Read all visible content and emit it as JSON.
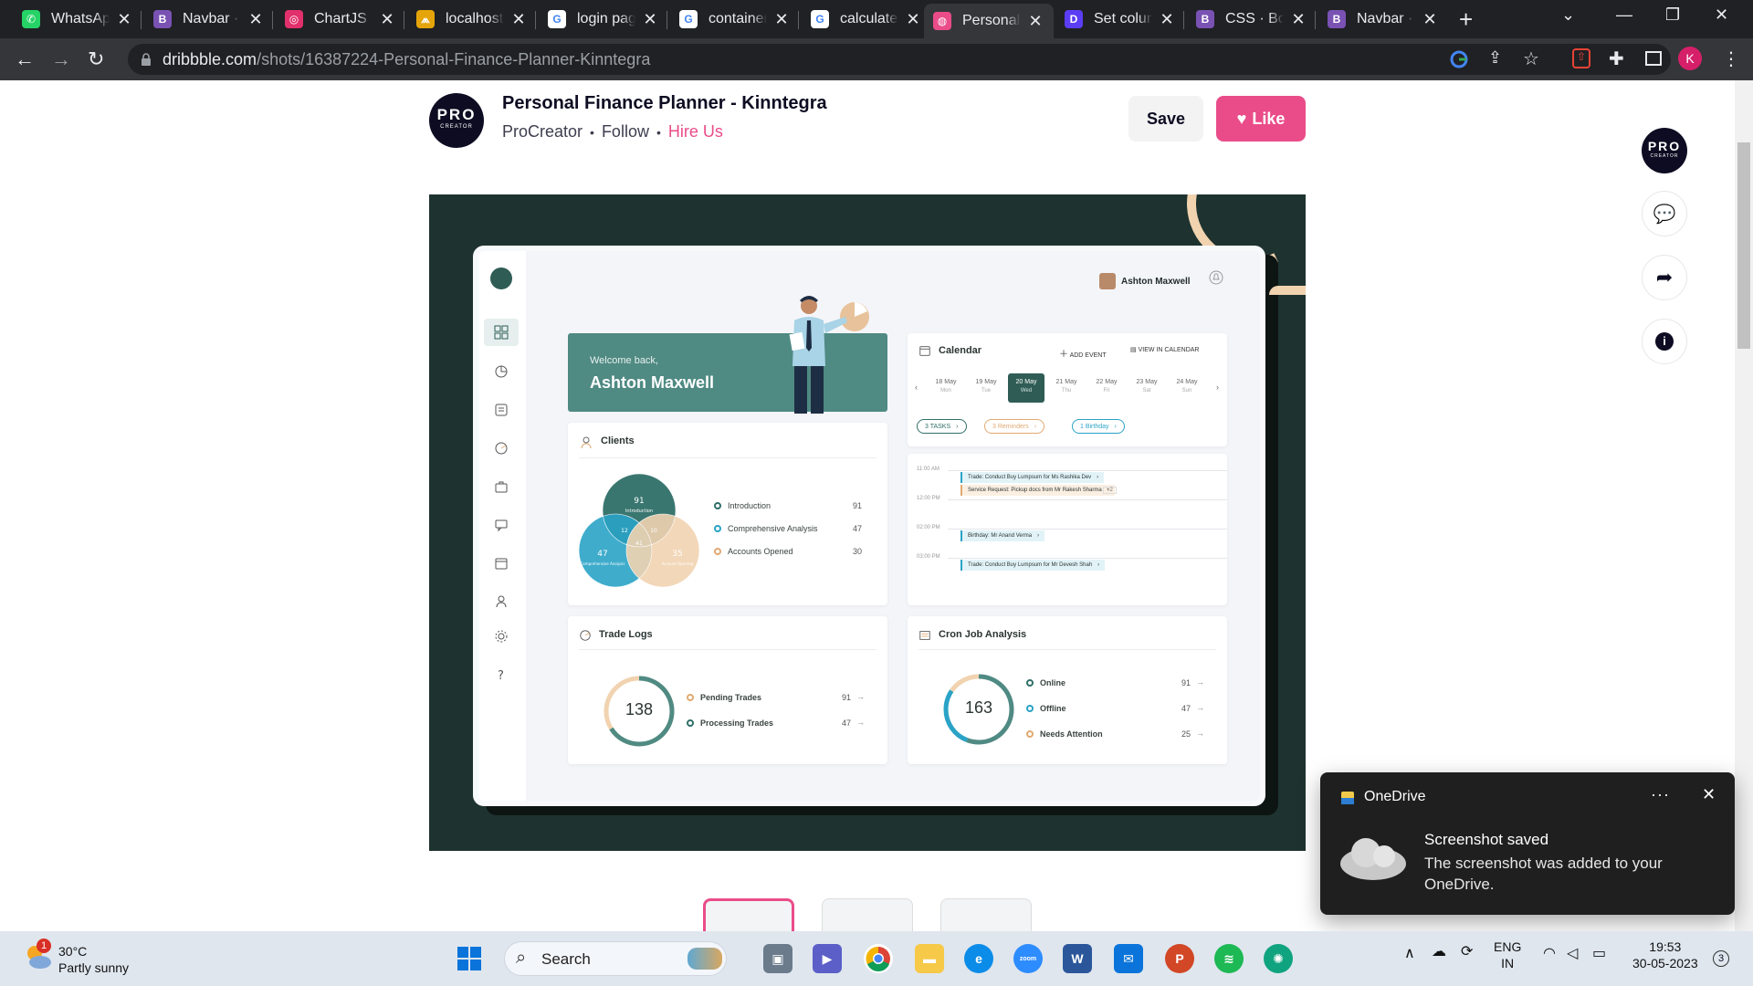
{
  "browser": {
    "tabs": [
      {
        "title": "WhatsApp",
        "icon": "whatsapp-icon",
        "color": "#25d366",
        "glyph": "✆"
      },
      {
        "title": "Navbar · B",
        "icon": "bootstrap-icon",
        "color": "#7952b3",
        "glyph": "B"
      },
      {
        "title": "ChartJS - ",
        "icon": "instagram-icon",
        "color": "#e1306c",
        "glyph": "◎"
      },
      {
        "title": "localhost",
        "icon": "localhost-icon",
        "color": "#e5a50a",
        "glyph": "⩕"
      },
      {
        "title": "login pag",
        "icon": "google-icon",
        "color": "#ffffff",
        "glyph": "G"
      },
      {
        "title": "container",
        "icon": "google-icon",
        "color": "#ffffff",
        "glyph": "G"
      },
      {
        "title": "calculate",
        "icon": "google-icon",
        "color": "#ffffff",
        "glyph": "G"
      },
      {
        "title": "Personal F",
        "icon": "dribbble-icon",
        "color": "#ea4c89",
        "glyph": "◍"
      },
      {
        "title": "Set colum",
        "icon": "dash-icon",
        "color": "#5b3df5",
        "glyph": "D"
      },
      {
        "title": "CSS · Boo",
        "icon": "bootstrap-icon",
        "color": "#7952b3",
        "glyph": "B"
      },
      {
        "title": "Navbar · B",
        "icon": "bootstrap-icon",
        "color": "#7952b3",
        "glyph": "B"
      }
    ],
    "active_tab_index": 7,
    "url_domain": "dribbble.com",
    "url_path": "/shots/16387224-Personal-Finance-Planner-Kinntegra",
    "profile_initial": "K"
  },
  "shot": {
    "title": "Personal Finance Planner - Kinntegra",
    "author": "ProCreator",
    "follow_label": "Follow",
    "hire_label": "Hire Us",
    "save_label": "Save",
    "like_label": "Like",
    "avatar_big": "PRO",
    "avatar_small": "CREATOR"
  },
  "dashboard": {
    "user_name": "Ashton Maxwell",
    "welcome_line": "Welcome back,",
    "welcome_name": "Ashton Maxwell",
    "clients": {
      "title": "Clients",
      "legend": [
        {
          "label": "Introduction",
          "value": "91",
          "color": "#2f6f68"
        },
        {
          "label": "Comprehensive Analysis",
          "value": "47",
          "color": "#2aa3c6"
        },
        {
          "label": "Accounts Opened",
          "value": "30",
          "color": "#e0a972"
        }
      ],
      "venn": {
        "top": "91",
        "top_sub": "Introduction",
        "left": "47",
        "left_sub": "Comprehensive Analysis",
        "right": "35",
        "right_sub": "Account Opening",
        "ab": "12",
        "ac": "10",
        "center": "41"
      }
    },
    "calendar": {
      "title": "Calendar",
      "add_event": "ADD EVENT",
      "view_in_calendar": "VIEW IN CALENDAR",
      "days": [
        {
          "date": "18 May",
          "dow": "Mon"
        },
        {
          "date": "19 May",
          "dow": "Tue"
        },
        {
          "date": "20 May",
          "dow": "Wed"
        },
        {
          "date": "21 May",
          "dow": "Thu"
        },
        {
          "date": "22 May",
          "dow": "Fri"
        },
        {
          "date": "23 May",
          "dow": "Sat"
        },
        {
          "date": "24 May",
          "dow": "Sun"
        }
      ],
      "selected_day_index": 2,
      "chips": [
        {
          "label": "3 TASKS",
          "color": "#2f6f68"
        },
        {
          "label": "3 Reminders",
          "color": "#e0a972"
        },
        {
          "label": "1 Birthday",
          "color": "#2aa3c6"
        }
      ],
      "times": [
        "11:00 AM",
        "12:00 PM",
        "02:00 PM",
        "03:00 PM"
      ],
      "events": [
        {
          "label": "Trade: Conduct Buy Lumpsum for Ms Rashika Dev",
          "color": "#2aa3c6",
          "bg": "#e2f3f8"
        },
        {
          "label": "Service Request: Pickup docs from Mr Rakesh Sharma",
          "color": "#e0a972",
          "bg": "#fbefe2"
        },
        {
          "label": "Birthday: Mr Anand Verma",
          "color": "#2aa3c6",
          "bg": "#e2f3f8"
        },
        {
          "label": "Trade: Conduct Buy Lumpsum for Mr Devesh Shah",
          "color": "#2aa3c6",
          "bg": "#e2f3f8"
        }
      ],
      "more": "+2"
    },
    "trade_logs": {
      "title": "Trade Logs",
      "total": "138",
      "legend": [
        {
          "label": "Pending Trades",
          "value": "91",
          "color": "#e0a972"
        },
        {
          "label": "Processing Trades",
          "value": "47",
          "color": "#2f6f68"
        }
      ],
      "ring_fraction": 0.66
    },
    "cron": {
      "title": "Cron Job Analysis",
      "total": "163",
      "legend": [
        {
          "label": "Online",
          "value": "91",
          "color": "#2f6f68"
        },
        {
          "label": "Offline",
          "value": "47",
          "color": "#2aa3c6"
        },
        {
          "label": "Needs Attention",
          "value": "25",
          "color": "#e0a972"
        }
      ]
    }
  },
  "toast": {
    "app": "OneDrive",
    "title": "Screenshot saved",
    "body": "The screenshot was added to your OneDrive."
  },
  "taskbar": {
    "temp": "30°C",
    "condition": "Partly sunny",
    "weather_badge": "1",
    "search_label": "Search",
    "lang1": "ENG",
    "lang2": "IN",
    "time": "19:53",
    "date": "30-05-2023",
    "notif_count": "3"
  }
}
